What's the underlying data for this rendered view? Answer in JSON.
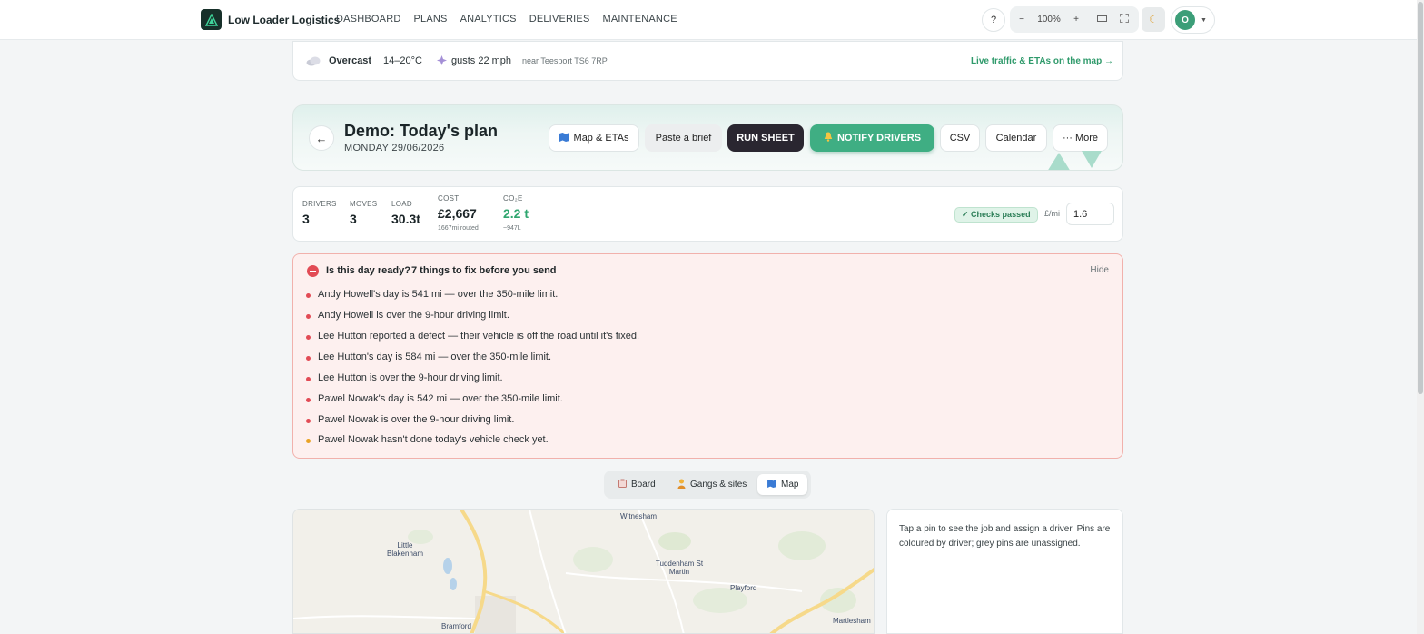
{
  "app": {
    "name": "Low Loader Logistics"
  },
  "nav": [
    "DASHBOARD",
    "PLANS",
    "ANALYTICS",
    "DELIVERIES",
    "MAINTENANCE"
  ],
  "toolbar": {
    "help": "?",
    "zoom_out": "−",
    "zoom": "100%",
    "zoom_in": "+",
    "avatar_initial": "O"
  },
  "weather": {
    "condition": "Overcast",
    "temp": "14–20°C",
    "wind": "gusts 22 mph",
    "location": "near Teesport TS6 7RP",
    "link": "Live traffic & ETAs on the map →"
  },
  "plan": {
    "back": "←",
    "title": "Demo: Today's plan",
    "date": "MONDAY 29/06/2026",
    "buttons": {
      "map_etas": "Map & ETAs",
      "paste_brief": "Paste a brief",
      "run_sheet": "RUN SHEET",
      "notify": "NOTIFY DRIVERS",
      "csv": "CSV",
      "calendar": "Calendar",
      "more": "··· More"
    }
  },
  "stats": {
    "drivers": {
      "label": "DRIVERS",
      "value": "3"
    },
    "moves": {
      "label": "MOVES",
      "value": "3"
    },
    "load": {
      "label": "LOAD",
      "value": "30.3t"
    },
    "cost": {
      "label": "COST",
      "value": "£2,667",
      "sub": "1667mi routed"
    },
    "co2": {
      "label": "CO₂E",
      "value": "2.2 t",
      "sub": "~947L"
    },
    "checks": "✓ Checks passed",
    "rate_label": "£/mi",
    "rate_value": "1.6"
  },
  "alert": {
    "question": "Is this day ready?",
    "count": "7 things to fix before you send",
    "hide": "Hide",
    "issues": [
      {
        "text": "Andy Howell's day is 541 mi — over the 350-mile limit.",
        "severity": "error"
      },
      {
        "text": "Andy Howell is over the 9-hour driving limit.",
        "severity": "error"
      },
      {
        "text": "Lee Hutton reported a defect — their vehicle is off the road until it's fixed.",
        "severity": "error"
      },
      {
        "text": "Lee Hutton's day is 584 mi — over the 350-mile limit.",
        "severity": "error"
      },
      {
        "text": "Lee Hutton is over the 9-hour driving limit.",
        "severity": "error"
      },
      {
        "text": "Pawel Nowak's day is 542 mi — over the 350-mile limit.",
        "severity": "error"
      },
      {
        "text": "Pawel Nowak is over the 9-hour driving limit.",
        "severity": "error"
      },
      {
        "text": "Pawel Nowak hasn't done today's vehicle check yet.",
        "severity": "warning"
      }
    ]
  },
  "views": {
    "board": "Board",
    "gangs": "Gangs & sites",
    "map": "Map",
    "active": "Map"
  },
  "map": {
    "places": [
      "Witnesham",
      "Little Blakenham",
      "Tuddenham St Martin",
      "Playford",
      "Bramford",
      "Martlesham"
    ]
  },
  "info": "Tap a pin to see the job and assign a driver. Pins are coloured by driver; grey pins are unassigned.",
  "colors": {
    "accent": "#3fae83",
    "error": "#e24b55",
    "warning": "#e9a224",
    "dark": "#2a2630"
  }
}
